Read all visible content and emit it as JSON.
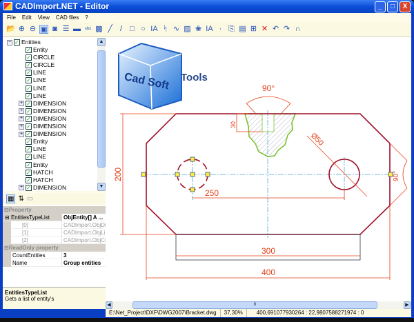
{
  "window": {
    "title": "CADImport.NET - Editor",
    "min": "_",
    "max": "□",
    "close": "X"
  },
  "menu": [
    "File",
    "Edit",
    "View",
    "CAD files",
    "?"
  ],
  "toolbar": [
    {
      "icon": "open-icon",
      "g": "📂"
    },
    {
      "icon": "zoom-in-icon",
      "g": "⊕"
    },
    {
      "icon": "zoom-out-icon",
      "g": "⊖"
    },
    {
      "icon": "fit-icon",
      "g": "▣"
    },
    {
      "icon": "view-icon",
      "g": "◙"
    },
    {
      "icon": "layers-icon",
      "g": "☰"
    },
    {
      "icon": "save-icon",
      "g": "▬"
    },
    {
      "icon": "shx-icon",
      "g": "shx"
    },
    {
      "icon": "image-icon",
      "g": "▩"
    },
    {
      "icon": "pen-icon",
      "g": "╱"
    },
    {
      "icon": "line-icon",
      "g": "/"
    },
    {
      "icon": "rectangle-icon",
      "g": "□"
    },
    {
      "icon": "circle-icon",
      "g": "○"
    },
    {
      "icon": "text-icon",
      "g": "IA"
    },
    {
      "icon": "polyline-icon",
      "g": "ᛋ"
    },
    {
      "icon": "spline-icon",
      "g": "∿"
    },
    {
      "icon": "hatch-icon",
      "g": "▨"
    },
    {
      "icon": "insert-icon",
      "g": "❀"
    },
    {
      "icon": "mtext-icon",
      "g": "IA"
    },
    {
      "icon": "point-icon",
      "g": "·"
    },
    {
      "icon": "copy-icon",
      "g": "⎘"
    },
    {
      "icon": "paste-icon",
      "g": "▤"
    },
    {
      "icon": "select-icon",
      "g": "⊞"
    },
    {
      "icon": "delete-icon",
      "g": "✕"
    },
    {
      "icon": "undo-icon",
      "g": "↶"
    },
    {
      "icon": "redo-icon",
      "g": "↷"
    },
    {
      "icon": "snap-magnet-icon",
      "g": "∩"
    }
  ],
  "tree": {
    "root": "Entities",
    "items": [
      {
        "label": "Entity",
        "expandable": false
      },
      {
        "label": "CIRCLE",
        "expandable": false
      },
      {
        "label": "CIRCLE",
        "expandable": false
      },
      {
        "label": "LINE",
        "expandable": false
      },
      {
        "label": "LINE",
        "expandable": false
      },
      {
        "label": "LINE",
        "expandable": false
      },
      {
        "label": "LINE",
        "expandable": false
      },
      {
        "label": "DIMENSION",
        "expandable": true
      },
      {
        "label": "DIMENSION",
        "expandable": true
      },
      {
        "label": "DIMENSION",
        "expandable": true
      },
      {
        "label": "DIMENSION",
        "expandable": true
      },
      {
        "label": "DIMENSION",
        "expandable": true
      },
      {
        "label": "Entity",
        "expandable": false
      },
      {
        "label": "LINE",
        "expandable": false
      },
      {
        "label": "LINE",
        "expandable": false
      },
      {
        "label": "Entity",
        "expandable": false
      },
      {
        "label": "HATCH",
        "expandable": false
      },
      {
        "label": "HATCH",
        "expandable": false
      },
      {
        "label": "DIMENSION",
        "expandable": true
      }
    ]
  },
  "properties": {
    "cat1": "Property",
    "cat2": "ReadOnly property",
    "rows": [
      {
        "k": "EntitiesTypeList",
        "v": "ObjEntity[] A ..."
      },
      {
        "k": "[0]",
        "v": "CADImport.ObjDim"
      },
      {
        "k": "[1]",
        "v": "CADImport.ObjLine"
      },
      {
        "k": "[2]",
        "v": "CADImport.ObjCirc"
      }
    ],
    "ro": [
      {
        "k": "CountEntities",
        "v": "3"
      },
      {
        "k": "Name",
        "v": "Group entities"
      }
    ],
    "desc_title": "EntitiesTypeList",
    "desc_text": "Gets a list of entity's"
  },
  "drawing": {
    "logo": "Cad Soft Tools",
    "dims": {
      "angle_top": "90°",
      "depth": "30",
      "diameter": "Ø50",
      "height": "200",
      "center_dist": "250",
      "bottom_width": "300",
      "total_width": "400",
      "angle_right": "90°"
    },
    "colors": {
      "outline": "#a0102a",
      "dimension": "#e8401a",
      "center": "#4aa8d8",
      "hatch_border": "#7cc030"
    }
  },
  "status": {
    "path": "E:\\Net_Project\\DXF\\DWG2007\\Bracket.dwg",
    "zoom": "37,30%",
    "coords": "400,691077930264 : 22,9807588271974 : 0"
  }
}
